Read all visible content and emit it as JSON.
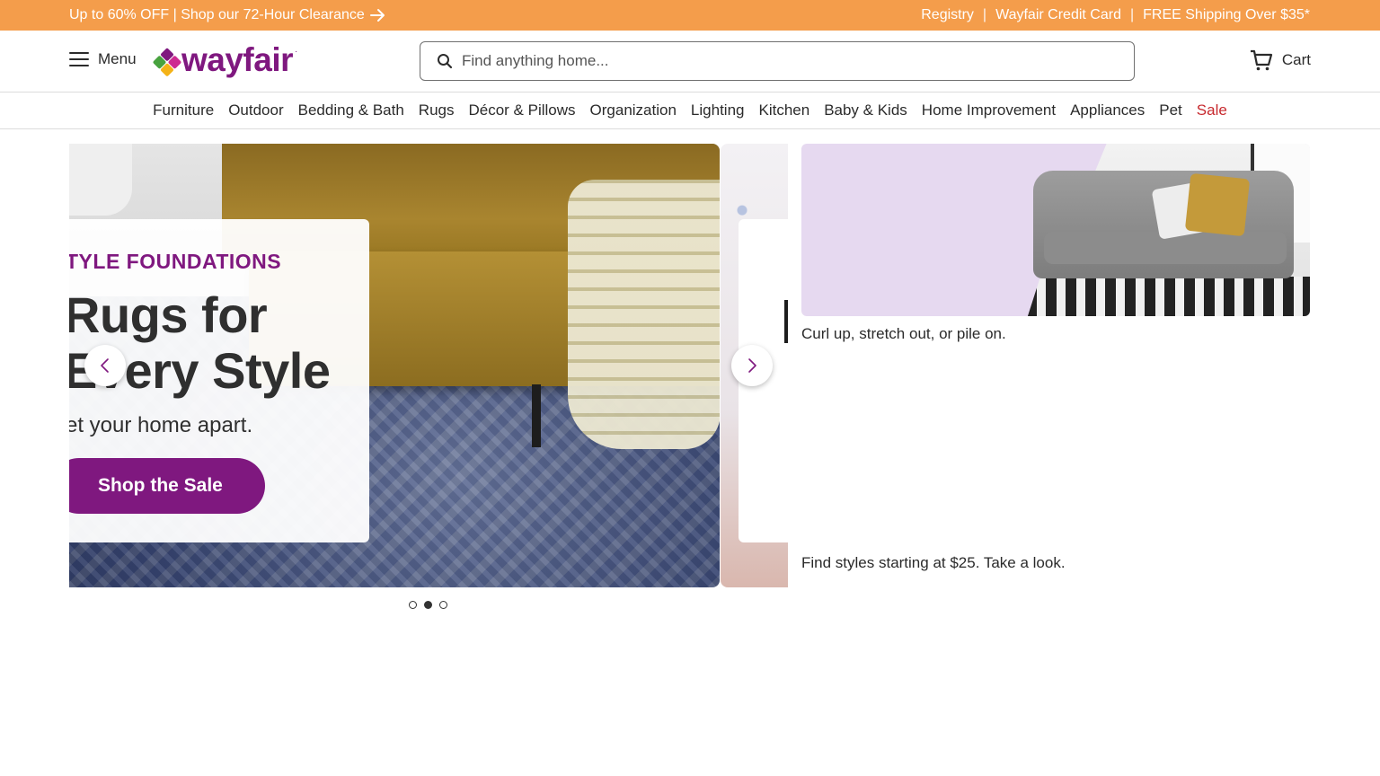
{
  "promo_bar": {
    "left_text": "Up to 60% OFF | Shop our 72-Hour Clearance",
    "links": [
      "Registry",
      "Wayfair Credit Card",
      "FREE Shipping Over $35*"
    ],
    "separator": "|",
    "color": "#f49d4b"
  },
  "header": {
    "menu_label": "Menu",
    "logo_text": "wayfair",
    "logo_mark": "·",
    "search_placeholder": "Find anything home...",
    "cart_label": "Cart",
    "brand_color": "#7f187f"
  },
  "nav": {
    "items": [
      "Furniture",
      "Outdoor",
      "Bedding & Bath",
      "Rugs",
      "Décor & Pillows",
      "Organization",
      "Lighting",
      "Kitchen",
      "Baby & Kids",
      "Home Improvement",
      "Appliances",
      "Pet",
      "Sale"
    ],
    "sale_color": "#c7292e"
  },
  "hero": {
    "eyebrow": "TYLE FOUNDATIONS",
    "title_line1": "Rugs for",
    "title_line2": "Every Style",
    "subtitle": "et your home apart.",
    "cta": "Shop the Sale",
    "active_slide": 2,
    "slide_count": 3
  },
  "side_promos": {
    "caption_top": "Curl up, stretch out, or pile on.",
    "caption_bottom": "Find styles starting at $25. Take a look."
  }
}
